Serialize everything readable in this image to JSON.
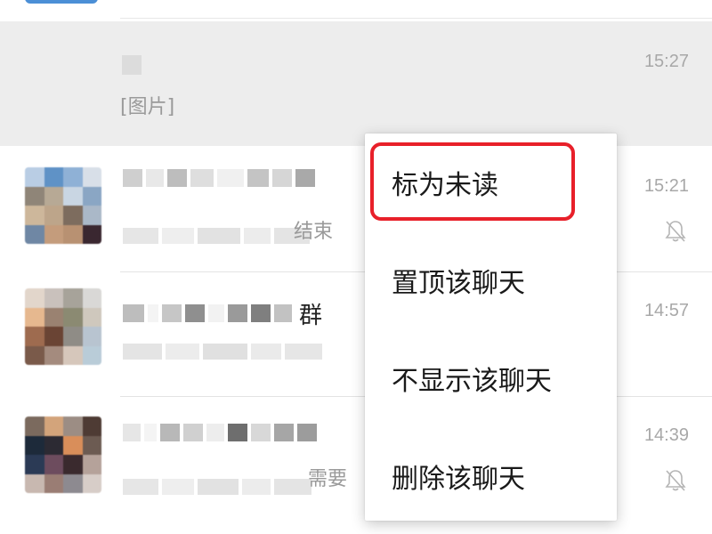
{
  "chats": [
    {
      "name_fragment": "",
      "last_message": "[图片]",
      "time": "15:27",
      "muted": false
    },
    {
      "name_fragment": "",
      "last_message_fragment": "结束",
      "time": "15:21",
      "muted": true
    },
    {
      "name_fragment": "群",
      "last_message_fragment": "",
      "time": "14:57",
      "muted": false
    },
    {
      "name_fragment": "",
      "last_message_fragment": "需要",
      "time": "14:39",
      "muted": true
    }
  ],
  "context_menu": {
    "items": [
      {
        "label": "标为未读"
      },
      {
        "label": "置顶该聊天"
      },
      {
        "label": "不显示该聊天"
      },
      {
        "label": "删除该聊天"
      }
    ],
    "highlighted_index": 0
  },
  "colors": {
    "highlight_row": "#ededed",
    "annotation_box": "#e8202a",
    "time_text": "#a8a8a8"
  },
  "icons": {
    "muted": "bell-slash-icon"
  }
}
